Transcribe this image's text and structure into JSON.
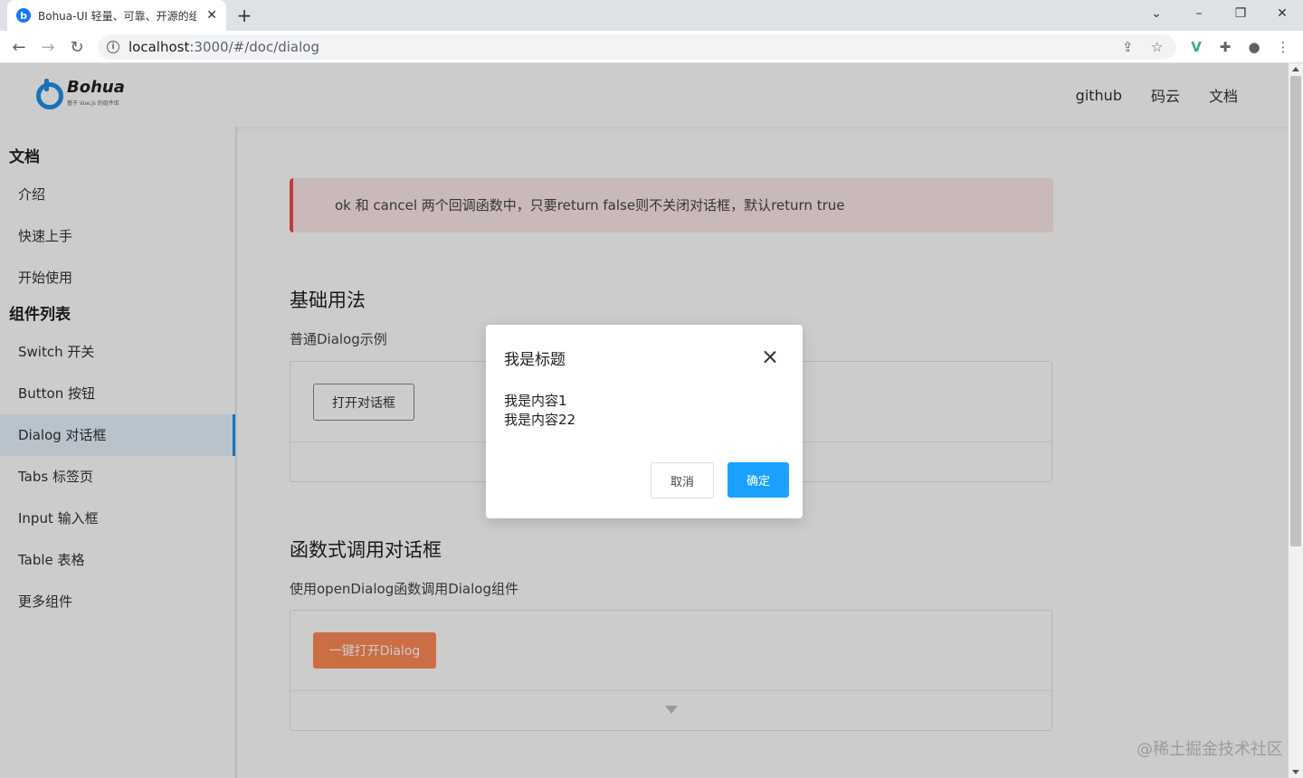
{
  "browser": {
    "tab_title": "Bohua-UI 轻量、可靠、开源的组件库",
    "url_host": "localhost",
    "url_rest": ":3000/#/doc/dialog"
  },
  "header": {
    "logo_text": "Bohua",
    "logo_sub": "基于 Vue.js 的组件库",
    "nav": [
      "github",
      "码云",
      "文档"
    ]
  },
  "sidebar": {
    "group_docs": "文档",
    "docs": [
      "介绍",
      "快速上手",
      "开始使用"
    ],
    "group_components": "组件列表",
    "components": [
      "Switch 开关",
      "Button 按钮",
      "Dialog 对话框",
      "Tabs 标签页",
      "Input 输入框",
      "Table 表格",
      "更多组件"
    ]
  },
  "content": {
    "tip": "ok 和 cancel 两个回调函数中，只要return false则不关闭对话框，默认return true",
    "section1_title": "基础用法",
    "section1_desc": "普通Dialog示例",
    "open_button": "打开对话框",
    "section2_title": "函数式调用对话框",
    "section2_desc": "使用openDialog函数调用Dialog组件",
    "one_click_button": "一键打开Dialog"
  },
  "dialog": {
    "title": "我是标题",
    "line1": "我是内容1",
    "line2": "我是内容22",
    "cancel": "取消",
    "ok": "确定"
  },
  "watermark": "@稀土掘金技术社区",
  "colors": {
    "primary": "#1aa0ff",
    "orange": "#fe8a54",
    "tip_border": "#f24b4b"
  }
}
